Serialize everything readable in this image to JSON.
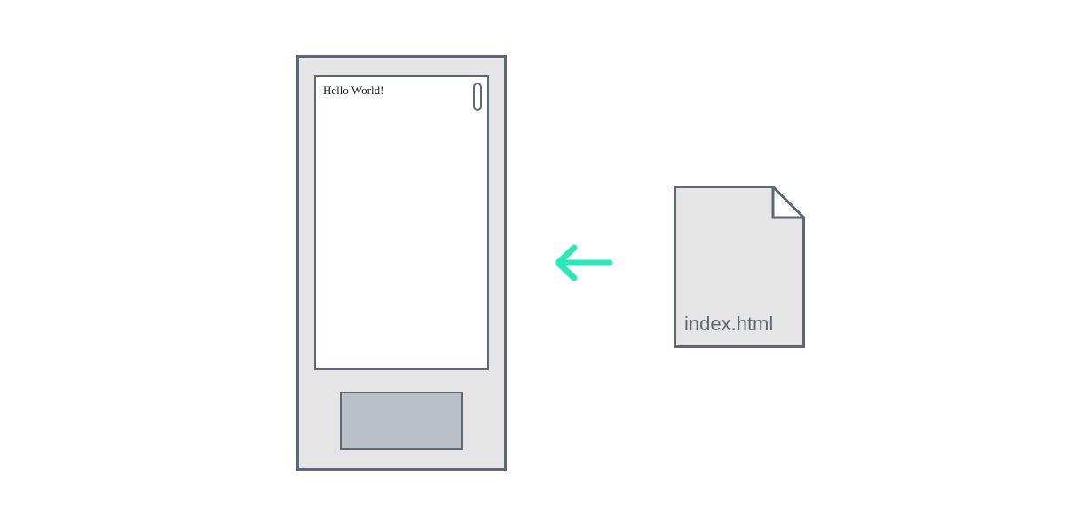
{
  "device": {
    "screen_text": "Hello World!"
  },
  "file": {
    "label": "index.html"
  },
  "colors": {
    "stroke": "#5e6776",
    "device_bg": "#e5e5e5",
    "file_bg": "#e5e5e5",
    "arrow": "#2ce8b6",
    "home_btn": "#bbbfc6"
  }
}
